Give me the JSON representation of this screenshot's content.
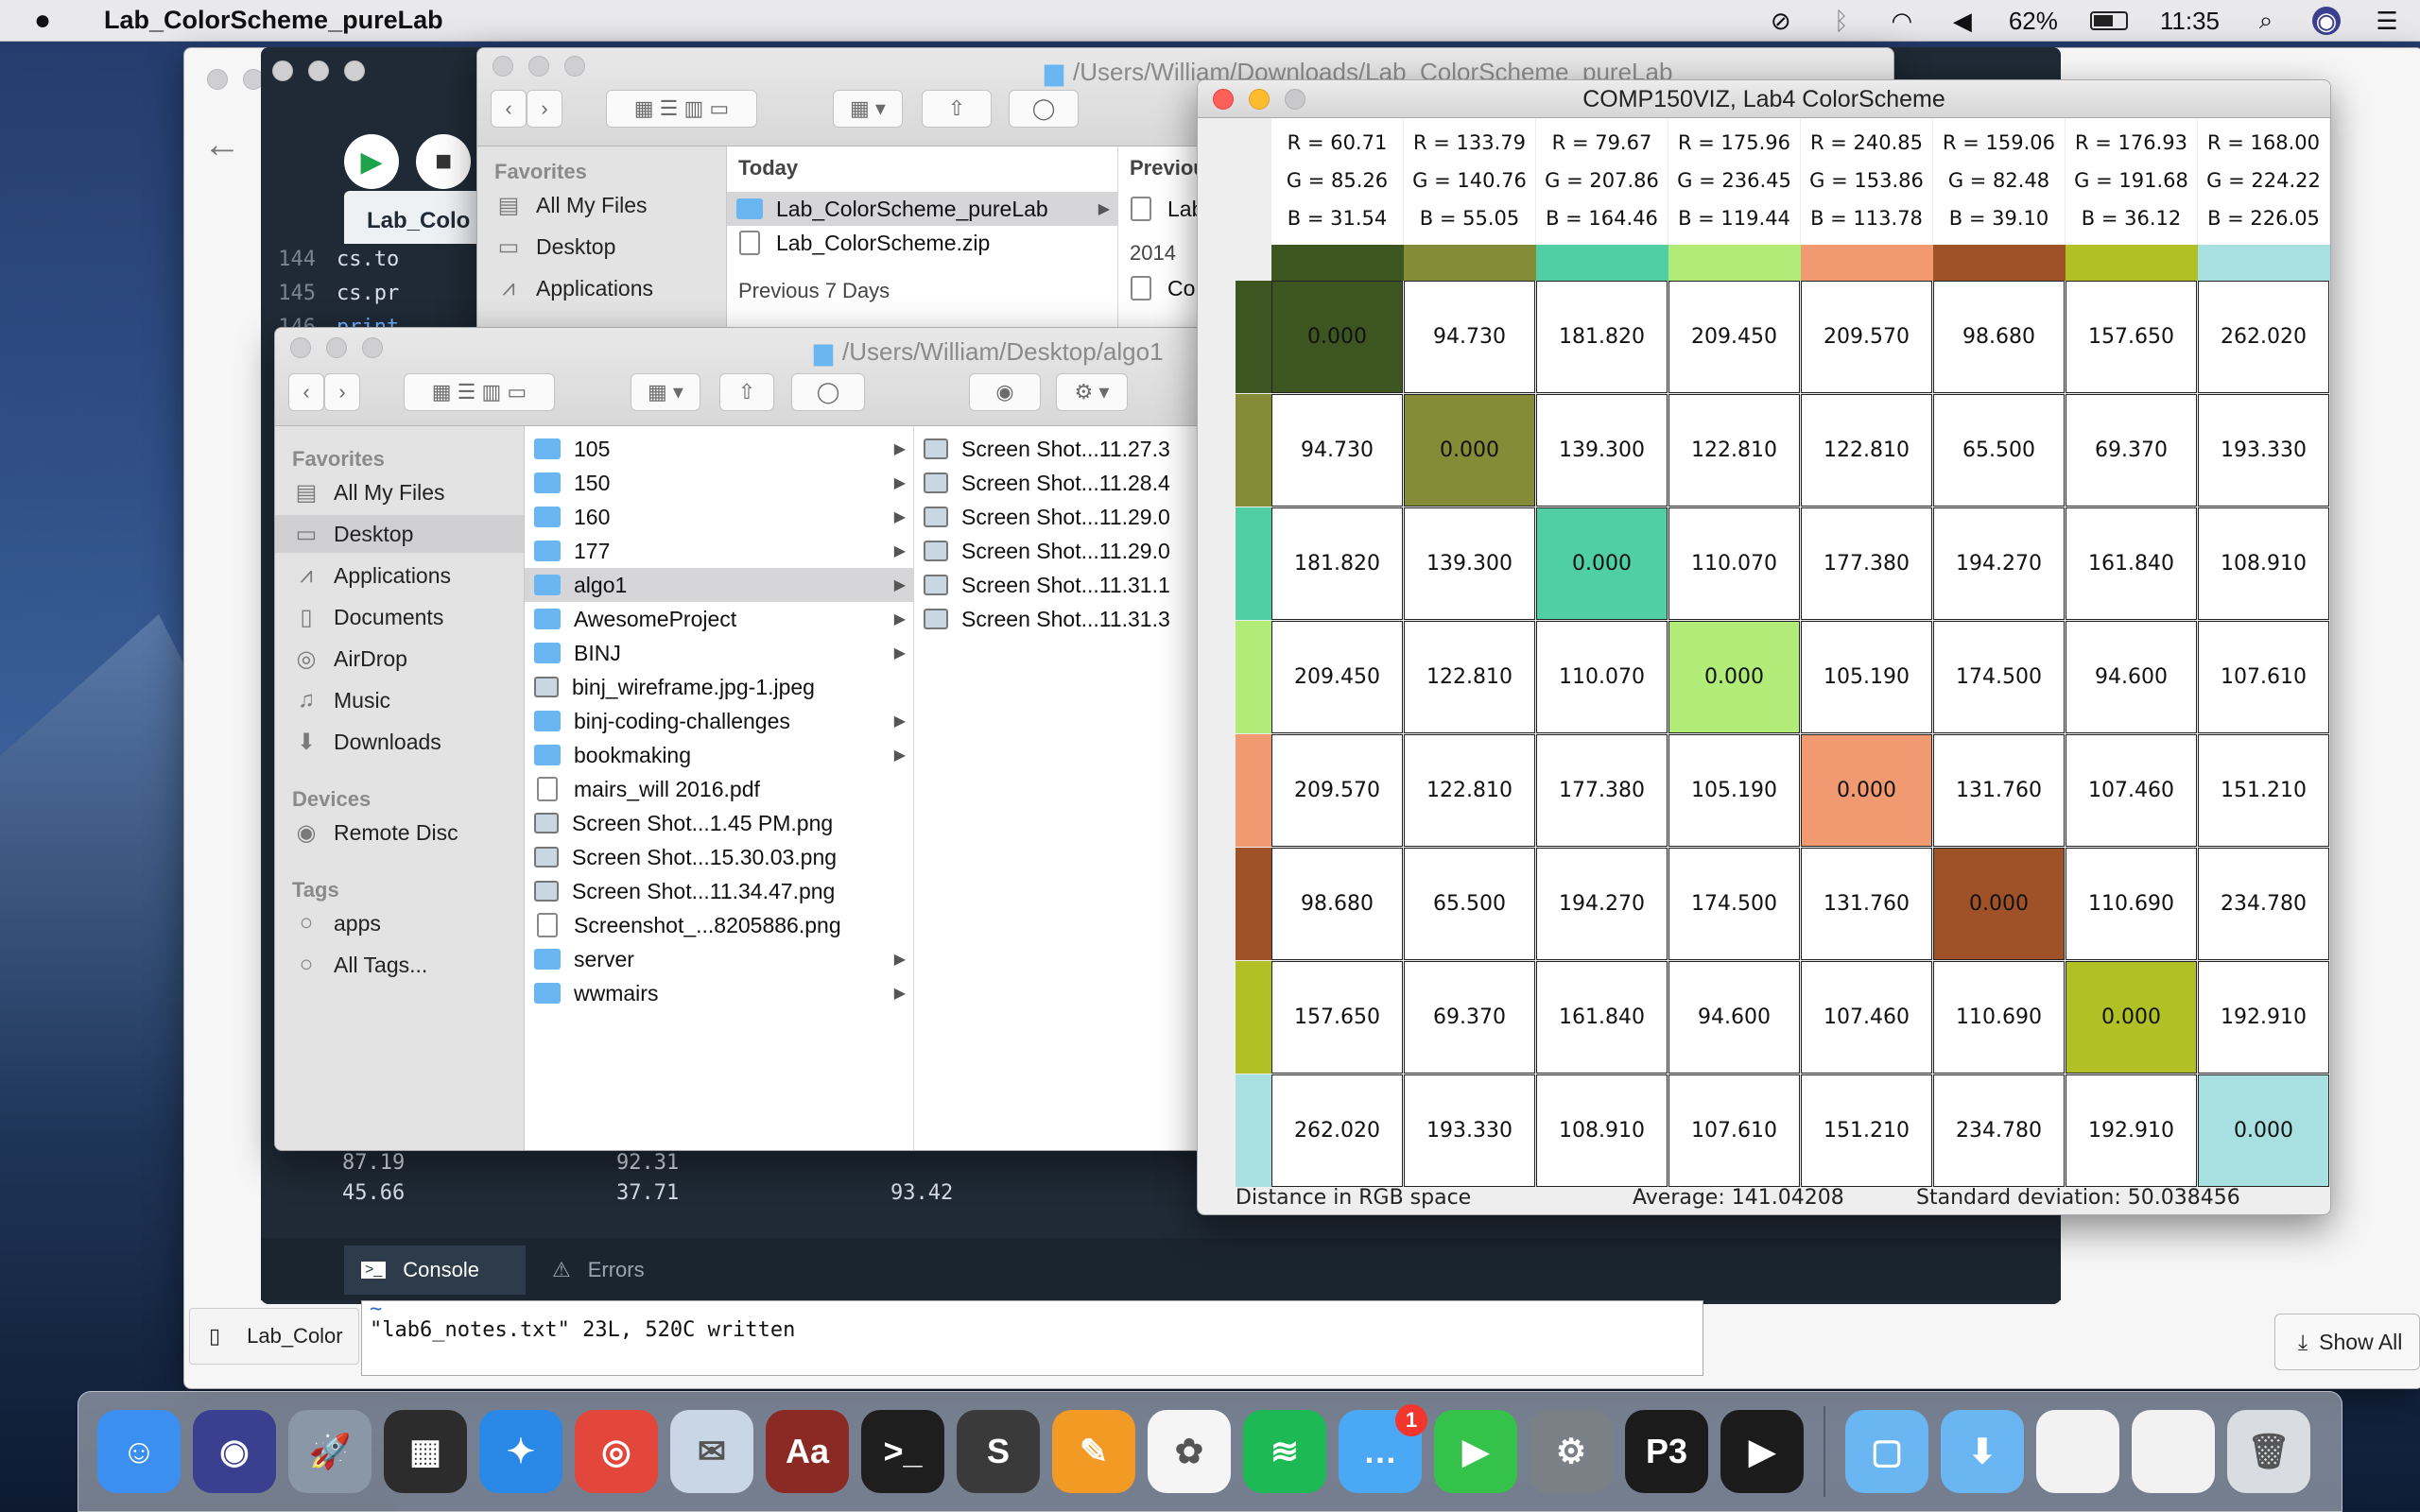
{
  "menubar": {
    "app_name": "Lab_ColorScheme_pureLab",
    "battery": "62%",
    "battery_level": 0.62,
    "clock": "11:35"
  },
  "ide": {
    "tab": "Lab_Colo",
    "lines": [
      {
        "n": "144",
        "code": "cs.to"
      },
      {
        "n": "145",
        "code": "cs.pr"
      },
      {
        "n": "146",
        "code": "print"
      }
    ],
    "output": [
      [
        "87.19",
        "92.31",
        ""
      ],
      [
        "45.66",
        "37.71",
        "93.42"
      ]
    ],
    "console_tab": "Console",
    "errors_tab": "Errors"
  },
  "terminal": {
    "tilde": "~",
    "line": "\"lab6_notes.txt\" 23L, 520C written"
  },
  "downloads_bar": {
    "item": "Lab_Color",
    "show_all": "Show All"
  },
  "finder_back": {
    "path": "/Users/William/Downloads/Lab_ColorScheme_pureLab",
    "sidebar_head": "Favorites",
    "sidebar": [
      "All My Files",
      "Desktop",
      "Applications"
    ],
    "col_head": "Today",
    "today": [
      {
        "name": "Lab_ColorScheme_pureLab",
        "kind": "folder"
      },
      {
        "name": "Lab_ColorScheme.zip",
        "kind": "doc"
      }
    ],
    "prev_head": "Previous 7 Days",
    "col2_head": "Previou",
    "col2_items": [
      "Lab",
      "2014",
      "Co"
    ]
  },
  "finder_front": {
    "path": "/Users/William/Desktop/algo1",
    "sidebar": {
      "favorites_head": "Favorites",
      "favorites": [
        {
          "label": "All My Files",
          "icon": "all-files-icon"
        },
        {
          "label": "Desktop",
          "icon": "desktop-icon"
        },
        {
          "label": "Applications",
          "icon": "applications-icon"
        },
        {
          "label": "Documents",
          "icon": "documents-icon"
        },
        {
          "label": "AirDrop",
          "icon": "airdrop-icon"
        },
        {
          "label": "Music",
          "icon": "music-icon"
        },
        {
          "label": "Downloads",
          "icon": "downloads-icon"
        }
      ],
      "devices_head": "Devices",
      "devices": [
        {
          "label": "Remote Disc",
          "icon": "disc-icon"
        }
      ],
      "tags_head": "Tags",
      "tags": [
        {
          "label": "apps"
        },
        {
          "label": "All Tags..."
        }
      ]
    },
    "col1": [
      {
        "name": "105",
        "kind": "folder",
        "arrow": true
      },
      {
        "name": "150",
        "kind": "folder",
        "arrow": true
      },
      {
        "name": "160",
        "kind": "folder",
        "arrow": true
      },
      {
        "name": "177",
        "kind": "folder",
        "arrow": true
      },
      {
        "name": "algo1",
        "kind": "folder",
        "arrow": true
      },
      {
        "name": "AwesomeProject",
        "kind": "folder",
        "arrow": true
      },
      {
        "name": "BINJ",
        "kind": "folder",
        "arrow": true
      },
      {
        "name": "binj_wireframe.jpg-1.jpeg",
        "kind": "img",
        "arrow": false
      },
      {
        "name": "binj-coding-challenges",
        "kind": "folder",
        "arrow": true
      },
      {
        "name": "bookmaking",
        "kind": "folder",
        "arrow": true
      },
      {
        "name": "mairs_will 2016.pdf",
        "kind": "doc",
        "arrow": false
      },
      {
        "name": "Screen Shot...1.45 PM.png",
        "kind": "img",
        "arrow": false
      },
      {
        "name": "Screen Shot...15.30.03.png",
        "kind": "img",
        "arrow": false
      },
      {
        "name": "Screen Shot...11.34.47.png",
        "kind": "img",
        "arrow": false
      },
      {
        "name": "Screenshot_...8205886.png",
        "kind": "doc",
        "arrow": false
      },
      {
        "name": "server",
        "kind": "folder",
        "arrow": true
      },
      {
        "name": "wwmairs",
        "kind": "folder",
        "arrow": true
      }
    ],
    "col2": [
      "Screen Shot...11.27.3",
      "Screen Shot...11.28.4",
      "Screen Shot...11.29.0",
      "Screen Shot...11.29.0",
      "Screen Shot...11.31.1",
      "Screen Shot...11.31.3"
    ]
  },
  "colorscheme": {
    "title": "COMP150VIZ, Lab4 ColorScheme",
    "colors": [
      {
        "r": "R = 60.71",
        "g": "G = 85.26",
        "b": "B = 31.54",
        "hex": "#3d5520"
      },
      {
        "r": "R = 133.79",
        "g": "G = 140.76",
        "b": "B = 55.05",
        "hex": "#858c37"
      },
      {
        "r": "R = 79.67",
        "g": "G = 207.86",
        "b": "B = 164.46",
        "hex": "#50cfa4"
      },
      {
        "r": "R = 175.96",
        "g": "G = 236.45",
        "b": "B = 119.44",
        "hex": "#b0ec77"
      },
      {
        "r": "R = 240.85",
        "g": "G = 153.86",
        "b": "B = 113.78",
        "hex": "#f19a72"
      },
      {
        "r": "R = 159.06",
        "g": "G = 82.48",
        "b": "B = 39.10",
        "hex": "#9f5227"
      },
      {
        "r": "R = 176.93",
        "g": "G = 191.68",
        "b": "B = 36.12",
        "hex": "#b1c024"
      },
      {
        "r": "R = 168.00",
        "g": "G = 224.22",
        "b": "B = 226.05",
        "hex": "#a8e0e2"
      }
    ],
    "matrix": [
      [
        "0.000",
        "94.730",
        "181.820",
        "209.450",
        "209.570",
        "98.680",
        "157.650",
        "262.020"
      ],
      [
        "94.730",
        "0.000",
        "139.300",
        "122.810",
        "122.810",
        "65.500",
        "69.370",
        "193.330"
      ],
      [
        "181.820",
        "139.300",
        "0.000",
        "110.070",
        "177.380",
        "194.270",
        "161.840",
        "108.910"
      ],
      [
        "209.450",
        "122.810",
        "110.070",
        "0.000",
        "105.190",
        "174.500",
        "94.600",
        "107.610"
      ],
      [
        "209.570",
        "122.810",
        "177.380",
        "105.190",
        "0.000",
        "131.760",
        "107.460",
        "151.210"
      ],
      [
        "98.680",
        "65.500",
        "194.270",
        "174.500",
        "131.760",
        "0.000",
        "110.690",
        "234.780"
      ],
      [
        "157.650",
        "69.370",
        "161.840",
        "94.600",
        "107.460",
        "110.690",
        "0.000",
        "192.910"
      ],
      [
        "262.020",
        "193.330",
        "108.910",
        "107.610",
        "151.210",
        "234.780",
        "192.910",
        "0.000"
      ]
    ],
    "status_left": "Distance in RGB space",
    "status_mid": "Average: 141.04208",
    "status_right": "Standard deviation: 50.038456"
  },
  "dock": [
    {
      "name": "Finder",
      "icon": "finder-icon",
      "color": "#3b8ff0",
      "glyph": "☺"
    },
    {
      "name": "Siri",
      "icon": "siri-icon",
      "color": "#3a3f8f",
      "glyph": "◉"
    },
    {
      "name": "Launchpad",
      "icon": "launchpad-icon",
      "color": "#8a97a6",
      "glyph": "🚀"
    },
    {
      "name": "Activity",
      "icon": "activity-icon",
      "color": "#2c2c2c",
      "glyph": "▦"
    },
    {
      "name": "Safari",
      "icon": "safari-icon",
      "color": "#2a89e6",
      "glyph": "✦"
    },
    {
      "name": "Chrome",
      "icon": "chrome-icon",
      "color": "#e3463a",
      "glyph": "◎"
    },
    {
      "name": "Mail",
      "icon": "mail-icon",
      "color": "#c9d6e6",
      "glyph": "✉"
    },
    {
      "name": "Dictionary",
      "icon": "dictionary-icon",
      "color": "#8b2a25",
      "glyph": "Aa"
    },
    {
      "name": "Terminal",
      "icon": "terminal-icon",
      "color": "#1e1e1e",
      "glyph": ">_"
    },
    {
      "name": "Sublime Text",
      "icon": "sublime-icon",
      "color": "#3a3a3a",
      "glyph": "S"
    },
    {
      "name": "Pages",
      "icon": "pages-icon",
      "color": "#f39a24",
      "glyph": "✎"
    },
    {
      "name": "Photos",
      "icon": "photos-icon",
      "color": "#f5f5f5",
      "glyph": "✿"
    },
    {
      "name": "Spotify",
      "icon": "spotify-icon",
      "color": "#1db954",
      "glyph": "≋"
    },
    {
      "name": "Messages",
      "icon": "messages-icon",
      "color": "#4aa8f5",
      "glyph": "…",
      "badge": "1"
    },
    {
      "name": "FaceTime",
      "icon": "facetime-icon",
      "color": "#34c24a",
      "glyph": "▶"
    },
    {
      "name": "System Preferences",
      "icon": "gear-icon",
      "color": "#7b7f86",
      "glyph": "⚙"
    },
    {
      "name": "Processing",
      "icon": "processing-icon",
      "color": "#1b1b1b",
      "glyph": "P3"
    },
    {
      "name": "Player",
      "icon": "play-icon",
      "color": "#1b1b1b",
      "glyph": "▶"
    },
    {
      "name": "Documents",
      "icon": "folder-icon",
      "color": "#6ab6f2",
      "glyph": "▢"
    },
    {
      "name": "Downloads",
      "icon": "downloads-folder-icon",
      "color": "#6ab6f2",
      "glyph": "⬇"
    },
    {
      "name": "Window 1",
      "icon": "window-thumb-icon",
      "color": "#f2f2f2",
      "glyph": ""
    },
    {
      "name": "Window 2",
      "icon": "window-thumb-icon",
      "color": "#f2f2f2",
      "glyph": ""
    },
    {
      "name": "Trash",
      "icon": "trash-icon",
      "color": "#d9dde2",
      "glyph": "🗑"
    }
  ]
}
